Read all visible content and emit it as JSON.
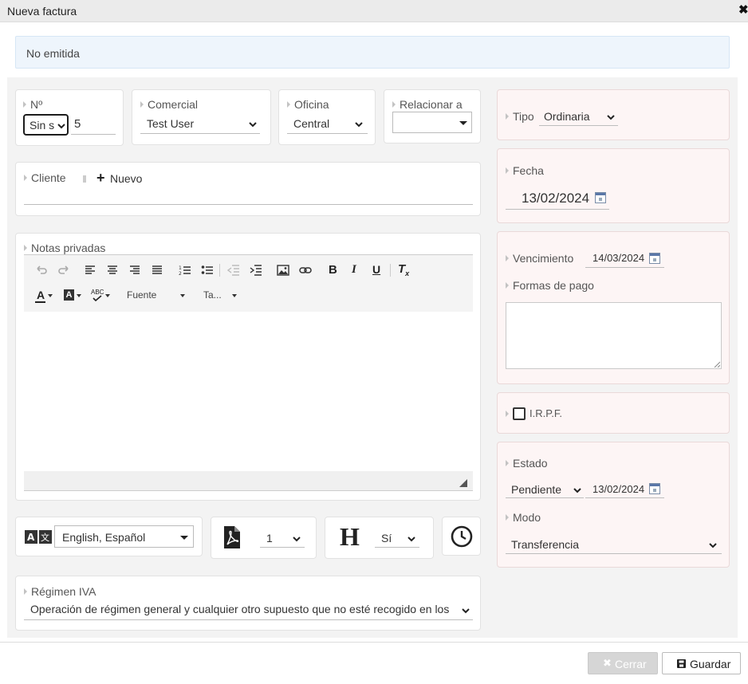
{
  "window": {
    "title": "Nueva factura",
    "close_label": "✖"
  },
  "notice": {
    "text": "No emitida"
  },
  "numero": {
    "label": "Nº",
    "serie_value": "Sin s",
    "number": "5"
  },
  "comercial": {
    "label": "Comercial",
    "value": "Test User"
  },
  "oficina": {
    "label": "Oficina",
    "value": "Central"
  },
  "relacionar": {
    "label": "Relacionar a",
    "value": ""
  },
  "cliente": {
    "label": "Cliente",
    "new_label": "Nuevo",
    "value": ""
  },
  "notas": {
    "label": "Notas privadas",
    "toolbar": {
      "font_label": "Fuente",
      "size_label": "Ta..."
    },
    "content": ""
  },
  "languages": {
    "value": "English, Español"
  },
  "pdf": {
    "value": "1"
  },
  "header": {
    "value": "Sí"
  },
  "regimen": {
    "label": "Régimen IVA",
    "value": "Operación de régimen general y cualquier otro supuesto que no esté recogido en los sig"
  },
  "tipo": {
    "label": "Tipo",
    "value": "Ordinaria"
  },
  "fecha": {
    "label": "Fecha",
    "value": "13/02/2024"
  },
  "vencimiento": {
    "label": "Vencimiento",
    "value": "14/03/2024"
  },
  "formas_pago": {
    "label": "Formas de pago",
    "value": ""
  },
  "irpf": {
    "label": "I.R.P.F.",
    "checked": false
  },
  "estado": {
    "label": "Estado",
    "value": "Pendiente",
    "date": "13/02/2024"
  },
  "modo": {
    "label": "Modo",
    "value": "Transferencia"
  },
  "footer": {
    "cerrar_label": "Cerrar",
    "guardar_label": "Guardar"
  },
  "colors": {
    "card_pink": "#fdf5f5",
    "notice_bg": "#eef5fc",
    "panel_bg": "#f3f3f3"
  }
}
